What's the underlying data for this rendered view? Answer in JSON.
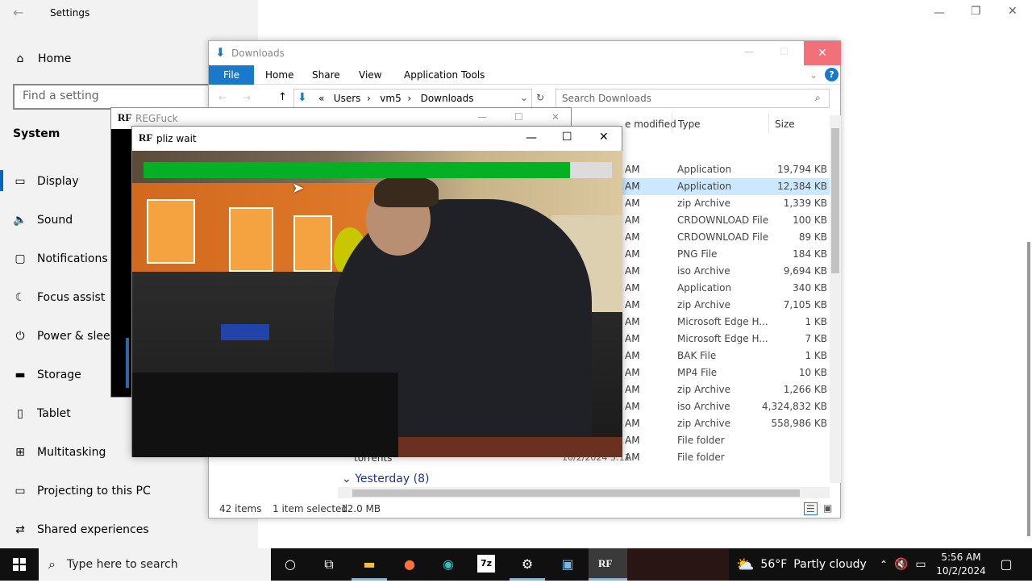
{
  "settings": {
    "title": "Settings",
    "home_label": "Home",
    "search_placeholder": "Find a setting",
    "section": "System",
    "nav": [
      {
        "label": "Display",
        "icon": "monitor-icon"
      },
      {
        "label": "Sound",
        "icon": "speaker-icon"
      },
      {
        "label": "Notifications &",
        "icon": "notification-icon"
      },
      {
        "label": "Focus assist",
        "icon": "moon-icon"
      },
      {
        "label": "Power & sleep",
        "icon": "power-icon"
      },
      {
        "label": "Storage",
        "icon": "storage-icon"
      },
      {
        "label": "Tablet",
        "icon": "tablet-icon"
      },
      {
        "label": "Multitasking",
        "icon": "multitask-icon"
      },
      {
        "label": "Projecting to this PC",
        "icon": "project-icon"
      },
      {
        "label": "Shared experiences",
        "icon": "shared-icon"
      }
    ]
  },
  "explorer": {
    "title": "Downloads",
    "ribbon": {
      "file": "File",
      "home": "Home",
      "share": "Share",
      "view": "View",
      "app_tools": "Application Tools"
    },
    "breadcrumb": {
      "prefix": "«",
      "p1": "Users",
      "p2": "vm5",
      "p3": "Downloads"
    },
    "search_placeholder": "Search Downloads",
    "columns": {
      "date": "e modified",
      "type": "Type",
      "size": "Size"
    },
    "rows": [
      {
        "time": "AM",
        "type": "Application",
        "size": "19,794 KB"
      },
      {
        "time": "AM",
        "type": "Application",
        "size": "12,384 KB"
      },
      {
        "time": "AM",
        "type": "zip Archive",
        "size": "1,339 KB"
      },
      {
        "time": "AM",
        "type": "CRDOWNLOAD File",
        "size": "100 KB"
      },
      {
        "time": "AM",
        "type": "CRDOWNLOAD File",
        "size": "89 KB"
      },
      {
        "time": "AM",
        "type": "PNG File",
        "size": "184 KB"
      },
      {
        "time": "AM",
        "type": "iso Archive",
        "size": "9,694 KB"
      },
      {
        "time": "AM",
        "type": "Application",
        "size": "340 KB"
      },
      {
        "time": "AM",
        "type": "zip Archive",
        "size": "7,105 KB"
      },
      {
        "time": "AM",
        "type": "Microsoft Edge H...",
        "size": "1 KB"
      },
      {
        "time": "AM",
        "type": "Microsoft Edge H...",
        "size": "7 KB"
      },
      {
        "time": "AM",
        "type": "BAK File",
        "size": "1 KB"
      },
      {
        "time": "AM",
        "type": "MP4 File",
        "size": "10 KB"
      },
      {
        "time": "AM",
        "type": "zip Archive",
        "size": "1,266 KB"
      },
      {
        "time": "AM",
        "type": "iso Archive",
        "size": "4,324,832 KB"
      },
      {
        "time": "AM",
        "type": "zip Archive",
        "size": "558,986 KB"
      },
      {
        "time": "AM",
        "type": "File folder",
        "size": ""
      },
      {
        "time": "AM",
        "type": "File folder",
        "size": ""
      }
    ],
    "torrents_name": "torrents",
    "torrents_date": "10/2/2024 5:11",
    "group_label": "Yesterday (8)",
    "status": {
      "items": "42 items",
      "selected": "1 item selected",
      "size": "12.0 MB"
    }
  },
  "regfuck": {
    "title": "REGFuck",
    "logo": "RF"
  },
  "pliz": {
    "title": "pliz wait",
    "logo": "RF",
    "progress": 0.91
  },
  "taskbar": {
    "search_placeholder": "Type here to search",
    "weather_temp": "56°F",
    "weather_desc": "Partly cloudy",
    "time": "5:56 AM",
    "date": "10/2/2024",
    "rf_label": "RF",
    "app_7z": "7z"
  },
  "colors": {
    "accent": "#0067c0",
    "progress": "#06b025",
    "close_hover": "#f1707a",
    "selection": "#cce8ff"
  }
}
